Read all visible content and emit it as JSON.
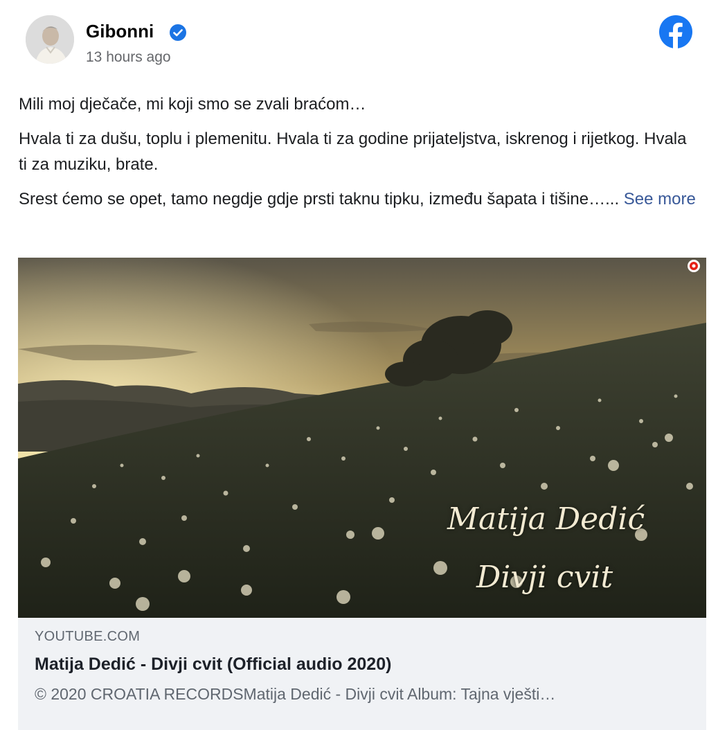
{
  "post": {
    "author": "Gibonni",
    "timestamp": "13 hours ago",
    "message": {
      "p1": "Mili moj dječače, mi koji smo se zvali braćom…",
      "p2": "Hvala ti za dušu, toplu i plemenitu. Hvala ti za godine prijateljstva, iskrenog i rijetkog. Hvala ti za muziku, brate.",
      "p3": "Srest ćemo se opet, tamo negdje gdje prsti taknu tipku, između šapata i tišine…...",
      "see_more": "See more"
    }
  },
  "icons": {
    "verified": "verified-badge-icon",
    "platform": "facebook-logo-icon",
    "avatar": "profile-photo"
  },
  "link_preview": {
    "image_overlay": {
      "line1": "Matija Dedić",
      "line2": "Divji cvit"
    },
    "domain": "YOUTUBE.COM",
    "title": "Matija Dedić - Divji cvit (Official audio 2020)",
    "description": "© 2020 CROATIA RECORDSMatija Dedić - Divji cvit Album: Tajna vješti…"
  },
  "colors": {
    "facebook_blue": "#1877f2",
    "verified_blue": "#1b74e4",
    "link_text": "#385898",
    "secondary_text": "#65676b",
    "card_bg": "#f0f2f5"
  }
}
